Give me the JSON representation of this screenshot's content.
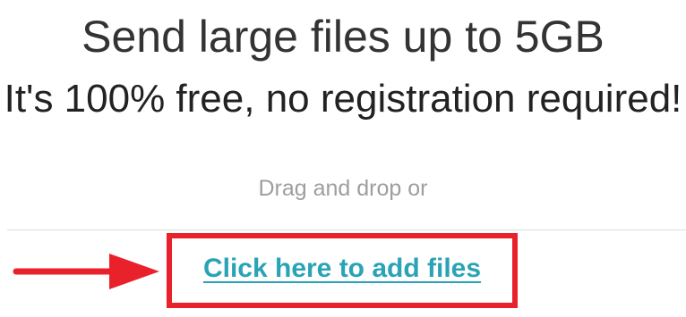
{
  "hero": {
    "title": "Send large files up to 5GB",
    "subtitle": "It's 100% free, no registration required!"
  },
  "upload": {
    "drag_text": "Drag and drop or",
    "add_files_link": "Click here to add files"
  },
  "annotation": {
    "highlight_color": "#e8212b",
    "arrow_icon": "right-arrow-icon"
  },
  "colors": {
    "link": "#2aa3b7",
    "title": "#333333",
    "muted": "#9e9e9e"
  }
}
